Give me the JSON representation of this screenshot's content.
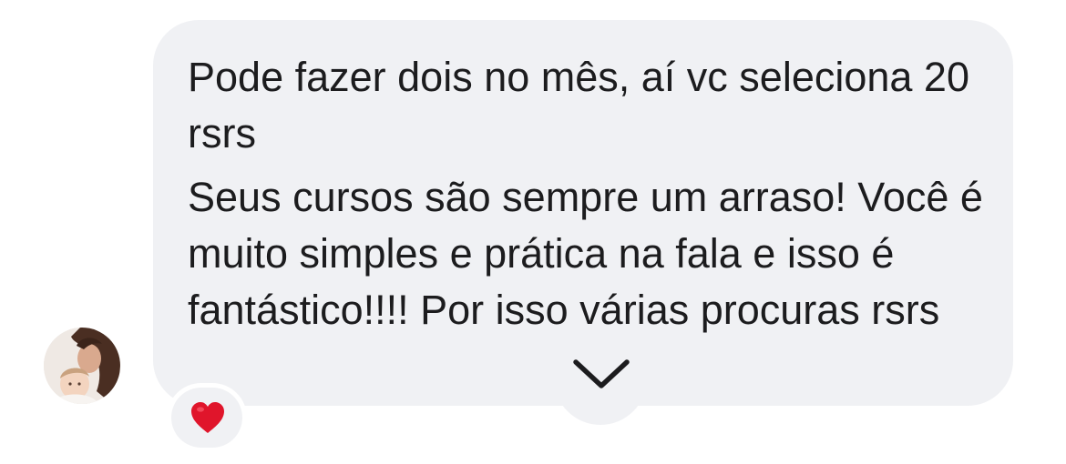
{
  "message": {
    "paragraphs": [
      "Pode fazer dois no mês, aí vc seleciona 20 rsrs",
      "Seus cursos são sempre um arraso! Você é muito simples e prática na fala e isso é fantástico!!!! Por isso várias procuras rsrs"
    ]
  },
  "reaction": {
    "icon": "heart-icon",
    "color": "#e0152b"
  },
  "expand_control": {
    "icon": "chevron-down-icon"
  },
  "colors": {
    "bubble": "#f0f1f4",
    "text": "#1c1c1e",
    "background": "#ffffff"
  }
}
